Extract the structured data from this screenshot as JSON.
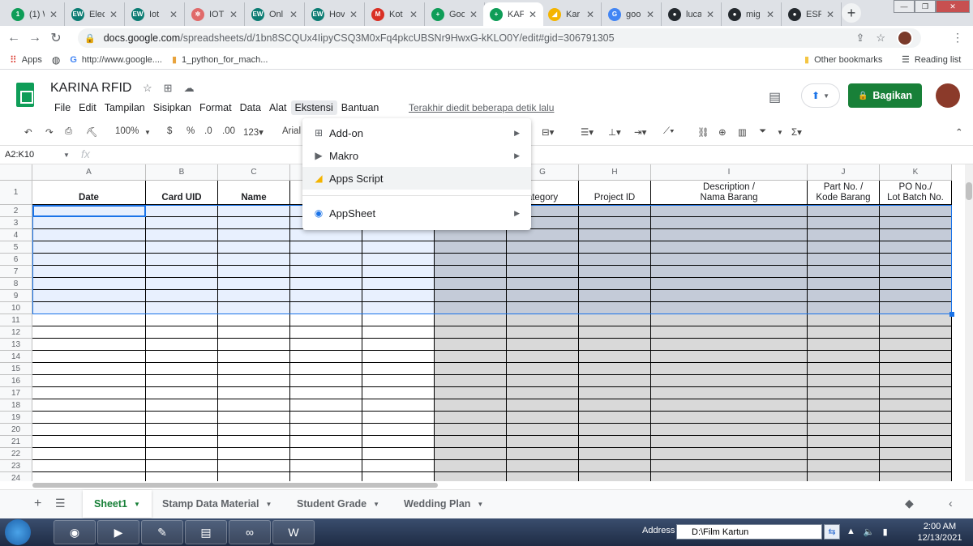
{
  "browser": {
    "tabs": [
      {
        "title": "(1) W",
        "fav_text": "1",
        "fav_color": "#0f9d58"
      },
      {
        "title": "Elec",
        "fav_text": "EW",
        "fav_color": "#0c7c73"
      },
      {
        "title": "Iot",
        "fav_text": "EW",
        "fav_color": "#0c7c73"
      },
      {
        "title": "IOT",
        "fav_text": "✲",
        "fav_color": "#e06a6a"
      },
      {
        "title": "Onl",
        "fav_text": "EW",
        "fav_color": "#0c7c73"
      },
      {
        "title": "Hov",
        "fav_text": "EW",
        "fav_color": "#0c7c73"
      },
      {
        "title": "Kot",
        "fav_text": "M",
        "fav_color": "#d93025"
      },
      {
        "title": "Goo",
        "fav_text": "+",
        "fav_color": "#0f9d58"
      },
      {
        "title": "KAF",
        "fav_text": "+",
        "fav_color": "#0f9d58",
        "active": true
      },
      {
        "title": "Kar",
        "fav_text": "◢",
        "fav_color": "#f4b400"
      },
      {
        "title": "goo",
        "fav_text": "G",
        "fav_color": "#4285f4"
      },
      {
        "title": "luca",
        "fav_text": "●",
        "fav_color": "#24292e"
      },
      {
        "title": "mig",
        "fav_text": "●",
        "fav_color": "#24292e"
      },
      {
        "title": "ESP",
        "fav_text": "●",
        "fav_color": "#24292e"
      }
    ],
    "new_tab": "+",
    "url_main": "docs.google.com",
    "url_rest": "/spreadsheets/d/1bn8SCQUx4IipyCSQ3M0xFq4pkcUBSNr9HwxG-kKLO0Y/edit#gid=306791305",
    "bookmarks": {
      "apps": "Apps",
      "google": "http://www.google....",
      "python": "1_python_for_mach...",
      "other": "Other bookmarks",
      "reading": "Reading list"
    }
  },
  "doc": {
    "title": "KARINA RFID",
    "menu": [
      "File",
      "Edit",
      "Tampilan",
      "Sisipkan",
      "Format",
      "Data",
      "Alat",
      "Ekstensi",
      "Bantuan"
    ],
    "last_edit": "Terakhir diedit beberapa detik lalu",
    "share": "Bagikan"
  },
  "toolbar": {
    "zoom": "100%",
    "currency": "$",
    "percent": "%",
    "dec_less": ".0",
    "dec_more": ".00",
    "numfmt": "123▾",
    "font": "Arial"
  },
  "formula": {
    "namebox": "A2:K10",
    "fx": "fx"
  },
  "grid": {
    "columns": [
      "A",
      "B",
      "C",
      "D",
      "E",
      "F",
      "G",
      "H",
      "I",
      "J",
      "K"
    ],
    "row_numbers": [
      "1",
      "2",
      "3",
      "4",
      "5",
      "6",
      "7",
      "8",
      "9",
      "10",
      "11",
      "12",
      "13",
      "14",
      "15",
      "16",
      "17",
      "18",
      "19",
      "20",
      "21",
      "22",
      "23",
      "24"
    ],
    "headers": {
      "A": "Date",
      "B": "Card UID",
      "C": "Name",
      "G": "ategory",
      "H": "Project ID",
      "I": [
        "Description /",
        "Nama Barang"
      ],
      "J": [
        "Part No. /",
        "Kode Barang"
      ],
      "K": [
        "PO No./",
        "Lot Batch No."
      ]
    }
  },
  "menu_dropdown": {
    "items": [
      {
        "label": "Add-on",
        "icon": "addon-icon",
        "submenu": true
      },
      {
        "label": "Makro",
        "icon": "macro-icon",
        "submenu": true
      },
      {
        "label": "Apps Script",
        "icon": "apps-script-icon",
        "submenu": false
      },
      {
        "label": "AppSheet",
        "icon": "appsheet-icon",
        "submenu": true
      }
    ]
  },
  "sheet_tabs": [
    {
      "label": "Sheet1",
      "active": true
    },
    {
      "label": "Stamp Data Material"
    },
    {
      "label": "Student Grade"
    },
    {
      "label": "Wedding Plan"
    }
  ],
  "taskbar": {
    "address_label": "Address",
    "address_value": "D:\\Film Kartun",
    "time": "2:00 AM",
    "date": "12/13/2021"
  },
  "colors": {
    "share_green": "#188038",
    "selection_blue": "#e8f0fe",
    "selection_border": "#1a73e8",
    "gray_fill": "#d9d9d9"
  }
}
